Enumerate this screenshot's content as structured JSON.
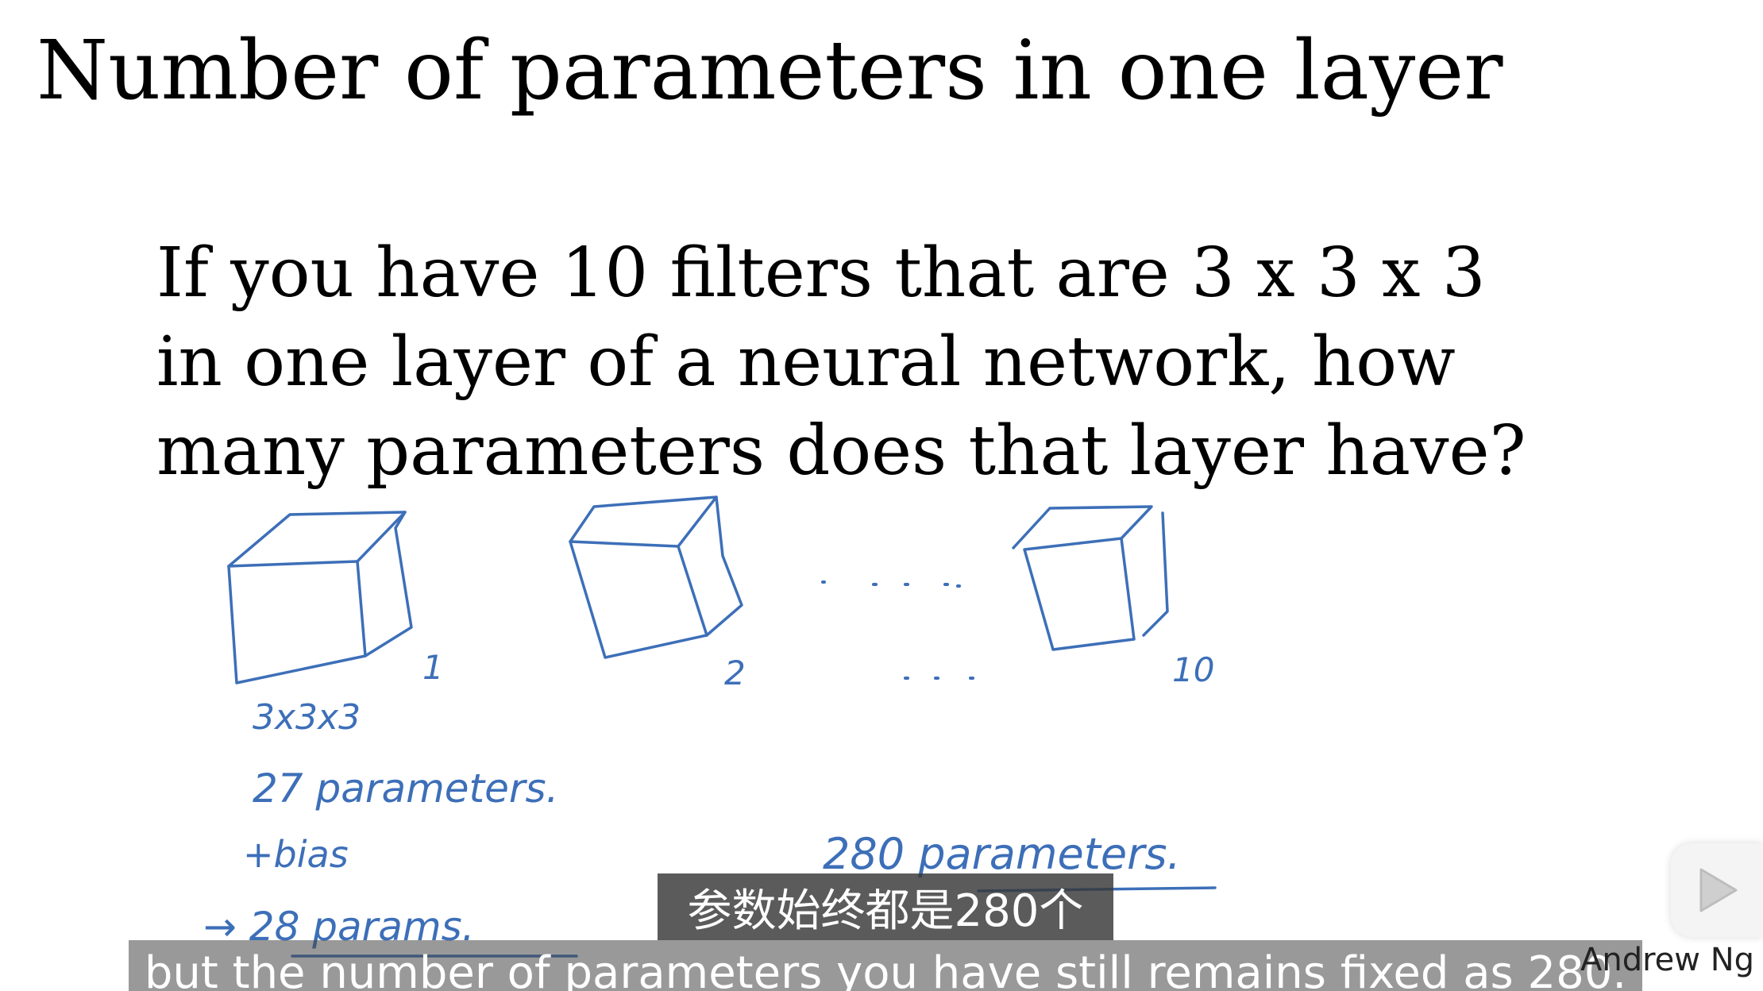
{
  "slide": {
    "title": "Number of parameters in one layer",
    "question_lines": [
      "If you have 10 filters that are 3 x 3 x 3",
      "in one layer of a neural network, how",
      "many parameters does that layer have?"
    ]
  },
  "handwriting": {
    "cube_labels": [
      "1",
      "2",
      "10"
    ],
    "dims": "3x3x3",
    "params_27": "27 parameters.",
    "bias": "+bias",
    "params_28": "→ 28 params.",
    "total": "280 parameters."
  },
  "subtitles": {
    "chinese": "参数始终都是280个",
    "english": "but the number of parameters you have still remains fixed as 280."
  },
  "author": "Andrew Ng",
  "colors": {
    "ink": "#3d6fb8",
    "subtitle_bg": "#373737",
    "play_icon": "#cfcfcf"
  },
  "icons": {
    "play": "play-icon"
  }
}
